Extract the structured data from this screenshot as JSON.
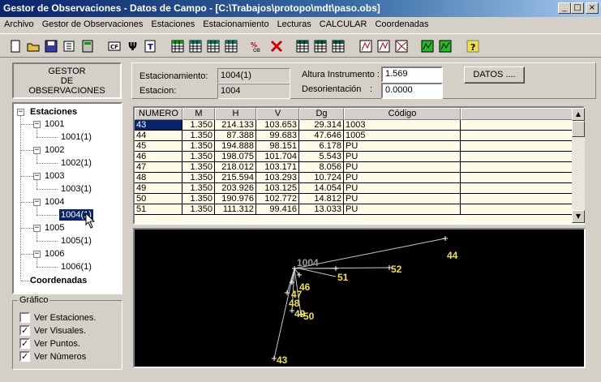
{
  "window": {
    "title": "Gestor de Observaciones - Datos de Campo - [C:\\Trabajos\\protopo\\mdt\\paso.obs]",
    "minimize": "_",
    "maximize": "□",
    "close": "×"
  },
  "menu": [
    "Archivo",
    "Gestor de Observaciones",
    "Estaciones",
    "Estacionamiento",
    "Lecturas",
    "CALCULAR",
    "Coordenadas"
  ],
  "toolbar_icons": [
    "new-icon",
    "open-icon",
    "save-icon",
    "export-icon",
    "calculator-icon",
    "cf-icon",
    "u-icon",
    "text-icon",
    "green-grid-icon",
    "grid-icon",
    "grid-icon",
    "grid-icon",
    "measure-icon",
    "delete-icon",
    "table-icon",
    "table-icon",
    "table-icon",
    "chart-icon",
    "chart-icon",
    "network-icon",
    "green-chart-icon",
    "green-chart-icon",
    "help-icon"
  ],
  "gestor": {
    "line1": "GESTOR",
    "line2": "DE",
    "line3": "OBSERVACIONES"
  },
  "tree": {
    "root": "Estaciones",
    "stations": [
      {
        "name": "1001",
        "child": "1001(1)"
      },
      {
        "name": "1002",
        "child": "1002(1)"
      },
      {
        "name": "1003",
        "child": "1003(1)"
      },
      {
        "name": "1004",
        "child": "1004(1)"
      },
      {
        "name": "1005",
        "child": "1005(1)"
      },
      {
        "name": "1006",
        "child": "1006(1)"
      }
    ],
    "coords": "Coordenadas",
    "selected": "1004(1)"
  },
  "grafico": {
    "legend": "Gráfico",
    "options": [
      {
        "label": "Ver Estaciones.",
        "checked": false
      },
      {
        "label": "Ver Visuales.",
        "checked": true
      },
      {
        "label": "Ver Puntos.",
        "checked": true
      },
      {
        "label": "Ver Números",
        "checked": true
      }
    ]
  },
  "info": {
    "estacionamiento_label": "Estacionamiento:",
    "estacionamiento_value": "1004(1)",
    "estacion_label": "Estacion:",
    "estacion_value": "1004",
    "altura_label": "Altura Instrumento :",
    "altura_value": "1.569",
    "desorientacion_label": "Desorientación",
    "desorientacion_colon": ":",
    "desorientacion_value": "0.0000",
    "datos_button": "DATOS ...."
  },
  "table": {
    "headers": [
      "NUMERO",
      "M",
      "H",
      "V",
      "Dg",
      "Código"
    ],
    "rows": [
      [
        "43",
        "1.350",
        "214.133",
        "103.653",
        "29.314",
        "1003"
      ],
      [
        "44",
        "1.350",
        "87.388",
        "99.683",
        "47.646",
        "1005"
      ],
      [
        "45",
        "1.350",
        "194.888",
        "98.151",
        "6.178",
        "PU"
      ],
      [
        "46",
        "1.350",
        "198.075",
        "101.704",
        "5.543",
        "PU"
      ],
      [
        "47",
        "1.350",
        "218.012",
        "103.171",
        "8.056",
        "PU"
      ],
      [
        "48",
        "1.350",
        "215.594",
        "103.293",
        "10.724",
        "PU"
      ],
      [
        "49",
        "1.350",
        "203.926",
        "103.125",
        "14.054",
        "PU"
      ],
      [
        "50",
        "1.350",
        "190.976",
        "102.772",
        "14.812",
        "PU"
      ],
      [
        "51",
        "1.350",
        "111.312",
        "99.416",
        "13.033",
        "PU"
      ]
    ],
    "selected_row": 0,
    "scroll_up": "▲",
    "scroll_down": "▼"
  },
  "plot": {
    "station_label": "1004",
    "station_color": "#9a9a9a",
    "point_color": "#f0e040",
    "line_color": "#c8c8c8",
    "points": [
      "44",
      "52",
      "51",
      "46",
      "47",
      "48",
      "49",
      "50",
      "43"
    ]
  }
}
